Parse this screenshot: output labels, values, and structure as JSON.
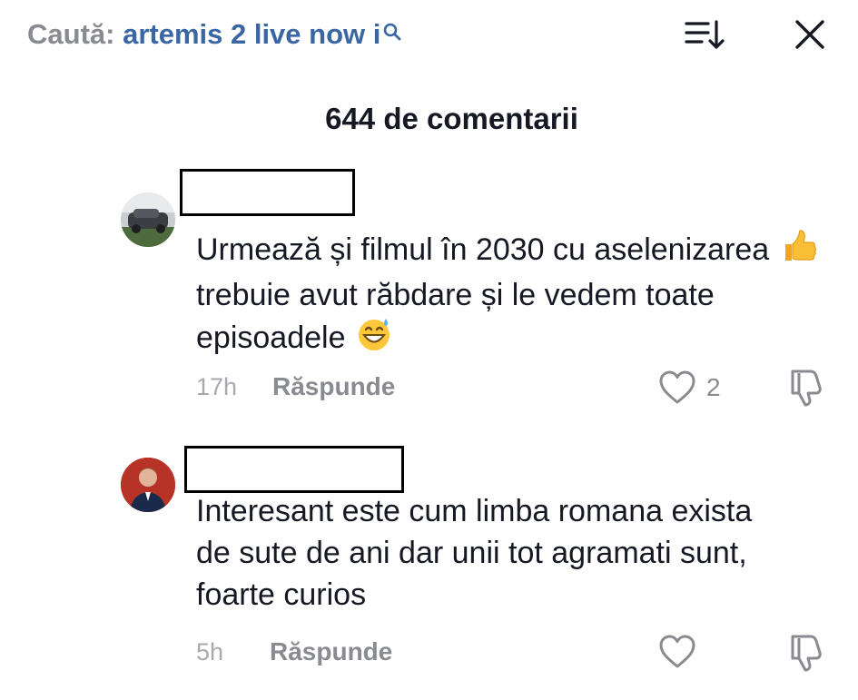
{
  "search": {
    "label": "Caută:",
    "query": "artemis 2 live now i"
  },
  "icons": {
    "search": "search-icon",
    "sort": "sort-icon",
    "close": "close-icon",
    "like": "heart-icon",
    "dislike": "thumbs-down-icon"
  },
  "title": "644 de comentarii",
  "comments": [
    {
      "text_parts": [
        "Urmează și filmul în 2030 cu aselenizarea",
        "trebuie avut răbdare și le vedem toate episoadele"
      ],
      "emojis": [
        "thumbs-up",
        "grinning-sweat"
      ],
      "time": "17h",
      "reply_label": "Răspunde",
      "likes": "2"
    },
    {
      "text": "Interesant este cum limba romana exista de sute de ani dar unii tot agramati sunt, foarte curios",
      "time": "5h",
      "reply_label": "Răspunde",
      "likes": ""
    }
  ],
  "colors": {
    "search_label": "#8a8b91",
    "search_query": "#3a66a3",
    "text": "#161823",
    "muted": "#8a8b91"
  }
}
